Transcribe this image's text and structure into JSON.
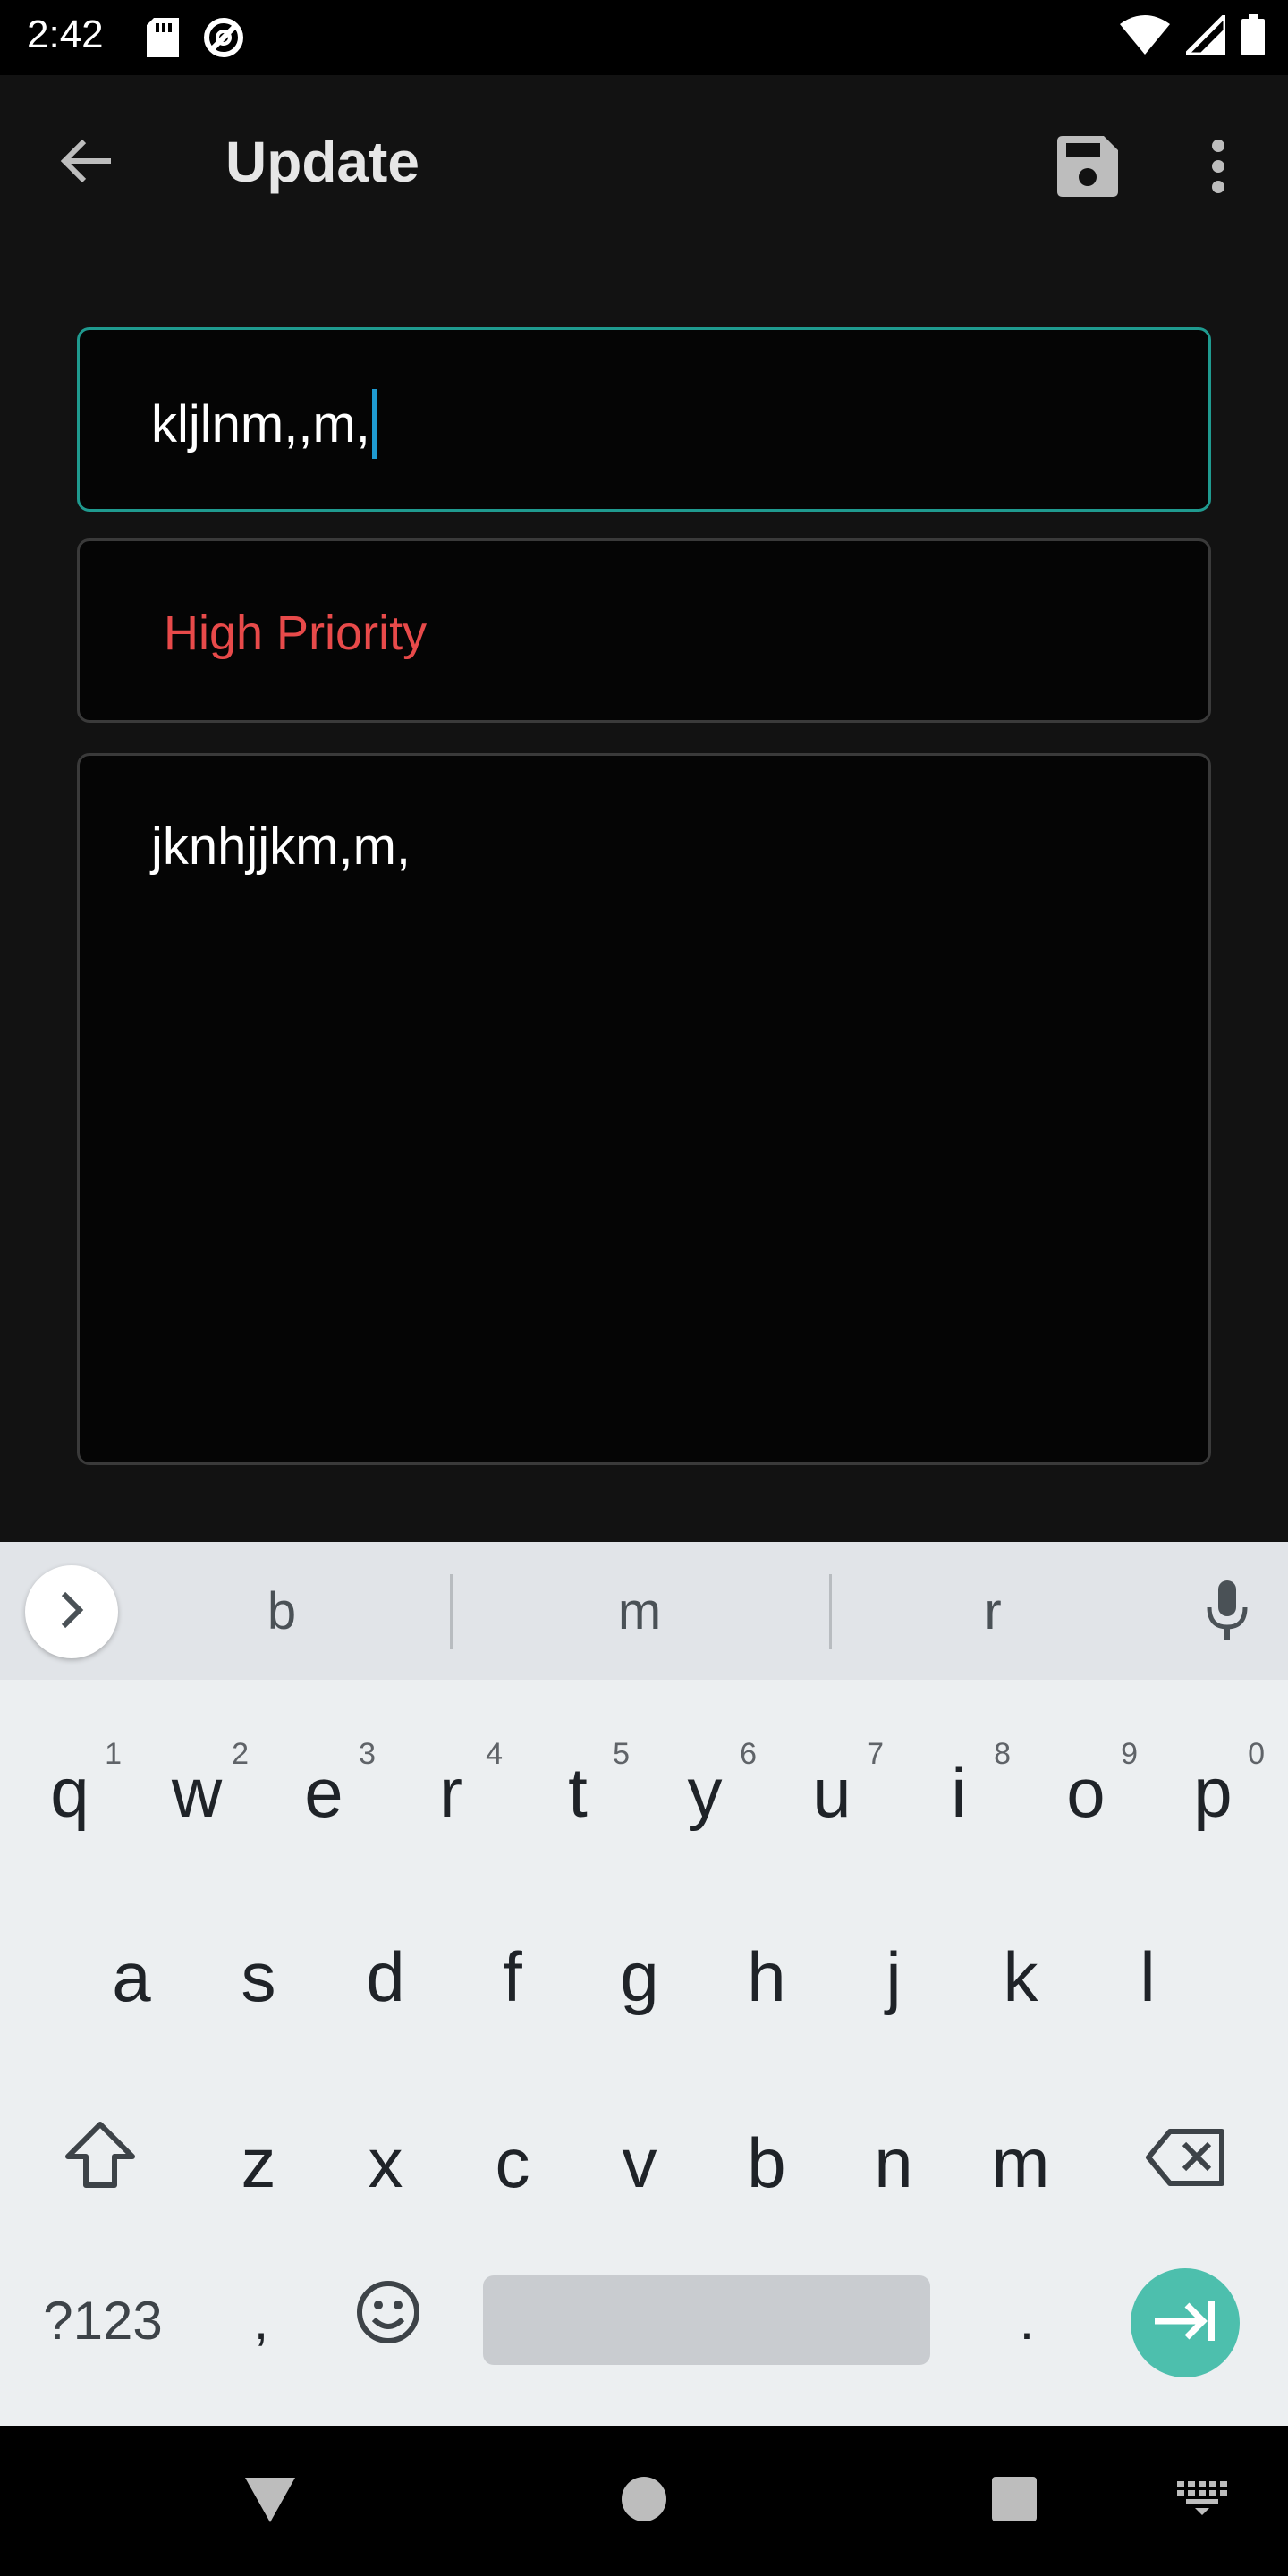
{
  "status_bar": {
    "time": "2:42",
    "icons": [
      "sd-card-icon",
      "data-saver-icon",
      "wifi-icon",
      "signal-icon",
      "battery-icon"
    ]
  },
  "app_bar": {
    "title": "Update",
    "icons": [
      "back-arrow-icon",
      "save-icon",
      "more-vert-icon"
    ]
  },
  "form": {
    "title_value": "kljlnm,,m,",
    "priority_value": "High Priority",
    "priority_color": "#e84a4a",
    "description_value": "jknhjjkm,m,",
    "focus_color": "#1f9a8f"
  },
  "keyboard": {
    "suggestions": [
      "b",
      "m",
      "r"
    ],
    "row1": [
      {
        "key": "q",
        "hint": "1"
      },
      {
        "key": "w",
        "hint": "2"
      },
      {
        "key": "e",
        "hint": "3"
      },
      {
        "key": "r",
        "hint": "4"
      },
      {
        "key": "t",
        "hint": "5"
      },
      {
        "key": "y",
        "hint": "6"
      },
      {
        "key": "u",
        "hint": "7"
      },
      {
        "key": "i",
        "hint": "8"
      },
      {
        "key": "o",
        "hint": "9"
      },
      {
        "key": "p",
        "hint": "0"
      }
    ],
    "row2": [
      "a",
      "s",
      "d",
      "f",
      "g",
      "h",
      "j",
      "k",
      "l"
    ],
    "row3": [
      "z",
      "x",
      "c",
      "v",
      "b",
      "n",
      "m"
    ],
    "row4": {
      "symbols": "?123",
      "comma": ",",
      "period": "."
    },
    "accent_color": "#4dbfad"
  },
  "nav_bar": {
    "icons": [
      "back-triangle-icon",
      "home-circle-icon",
      "recents-square-icon",
      "keyboard-switch-icon"
    ]
  }
}
